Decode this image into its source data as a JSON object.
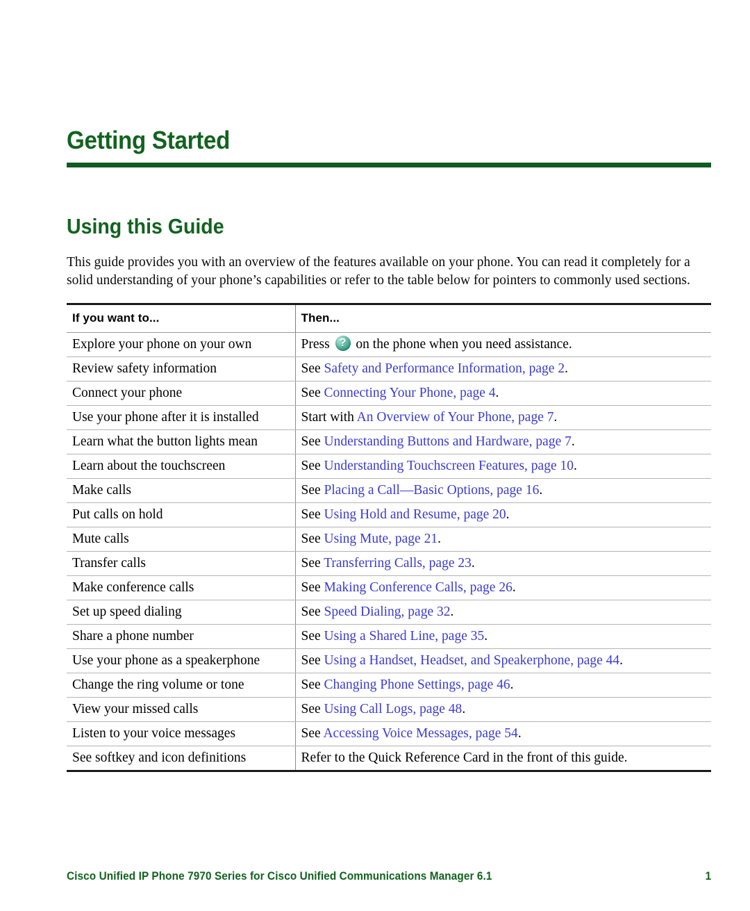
{
  "colors": {
    "heading_green": "#12631f",
    "rule_green": "#0f5b22",
    "link_blue": "#3b3bd2",
    "body_black": "#000000",
    "row_separator": "#b4b4b4",
    "table_border_dark": "#1a1a1a",
    "help_icon_teal": "#2f9e83"
  },
  "chapter": {
    "title": "Getting Started"
  },
  "section": {
    "title": "Using this Guide",
    "intro": "This guide provides you with an overview of the features available on your phone. You can read it completely for a solid understanding of your phone’s capabilities or refer to the table below for pointers to commonly used sections."
  },
  "table": {
    "headers": {
      "col1": "If you want to...",
      "col2": "Then..."
    },
    "rows": [
      {
        "want": "Explore your phone on your own",
        "then_prefix": "Press ",
        "icon": "help-question-icon",
        "then_suffix": " on the phone when you need assistance.",
        "link": "",
        "tail": ""
      },
      {
        "want": "Review safety information",
        "then_prefix": "See ",
        "link": "Safety and Performance Information, page 2",
        "tail": "."
      },
      {
        "want": "Connect your phone",
        "then_prefix": "See ",
        "link": "Connecting Your Phone, page 4",
        "tail": "."
      },
      {
        "want": "Use your phone after it is installed",
        "then_prefix": "Start with ",
        "link": "An Overview of Your Phone, page 7",
        "tail": "."
      },
      {
        "want": "Learn what the button lights mean",
        "then_prefix": "See ",
        "link": "Understanding Buttons and Hardware, page 7",
        "tail": "."
      },
      {
        "want": "Learn about the touchscreen",
        "then_prefix": "See ",
        "link": "Understanding Touchscreen Features, page 10",
        "tail": "."
      },
      {
        "want": "Make calls",
        "then_prefix": "See ",
        "link": "Placing a Call—Basic Options, page 16",
        "tail": "."
      },
      {
        "want": "Put calls on hold",
        "then_prefix": "See ",
        "link": "Using Hold and Resume, page 20",
        "tail": "."
      },
      {
        "want": "Mute calls",
        "then_prefix": "See ",
        "link": "Using Mute, page 21",
        "tail": "."
      },
      {
        "want": "Transfer calls",
        "then_prefix": "See ",
        "link": "Transferring Calls, page 23",
        "tail": "."
      },
      {
        "want": "Make conference calls",
        "then_prefix": "See ",
        "link": "Making Conference Calls, page 26",
        "tail": "."
      },
      {
        "want": "Set up speed dialing",
        "then_prefix": "See ",
        "link": "Speed Dialing, page 32",
        "tail": "."
      },
      {
        "want": "Share a phone number",
        "then_prefix": "See ",
        "link": "Using a Shared Line, page 35",
        "tail": "."
      },
      {
        "want": "Use your phone as a speakerphone",
        "then_prefix": "See ",
        "link": "Using a Handset, Headset, and Speakerphone, page 44",
        "tail": "."
      },
      {
        "want": "Change the ring volume or tone",
        "then_prefix": "See ",
        "link": "Changing Phone Settings, page 46",
        "tail": "."
      },
      {
        "want": "View your missed calls",
        "then_prefix": "See ",
        "link": "Using Call Logs, page 48",
        "tail": "."
      },
      {
        "want": "Listen to your voice messages",
        "then_prefix": "See ",
        "link": "Accessing Voice Messages, page 54",
        "tail": "."
      },
      {
        "want": "See softkey and icon definitions",
        "then_prefix": "Refer to the Quick Reference Card in the front of this guide.",
        "link": "",
        "tail": ""
      }
    ]
  },
  "footer": {
    "text": "Cisco Unified IP Phone 7970 Series for Cisco Unified Communications Manager 6.1",
    "page_number": "1"
  }
}
